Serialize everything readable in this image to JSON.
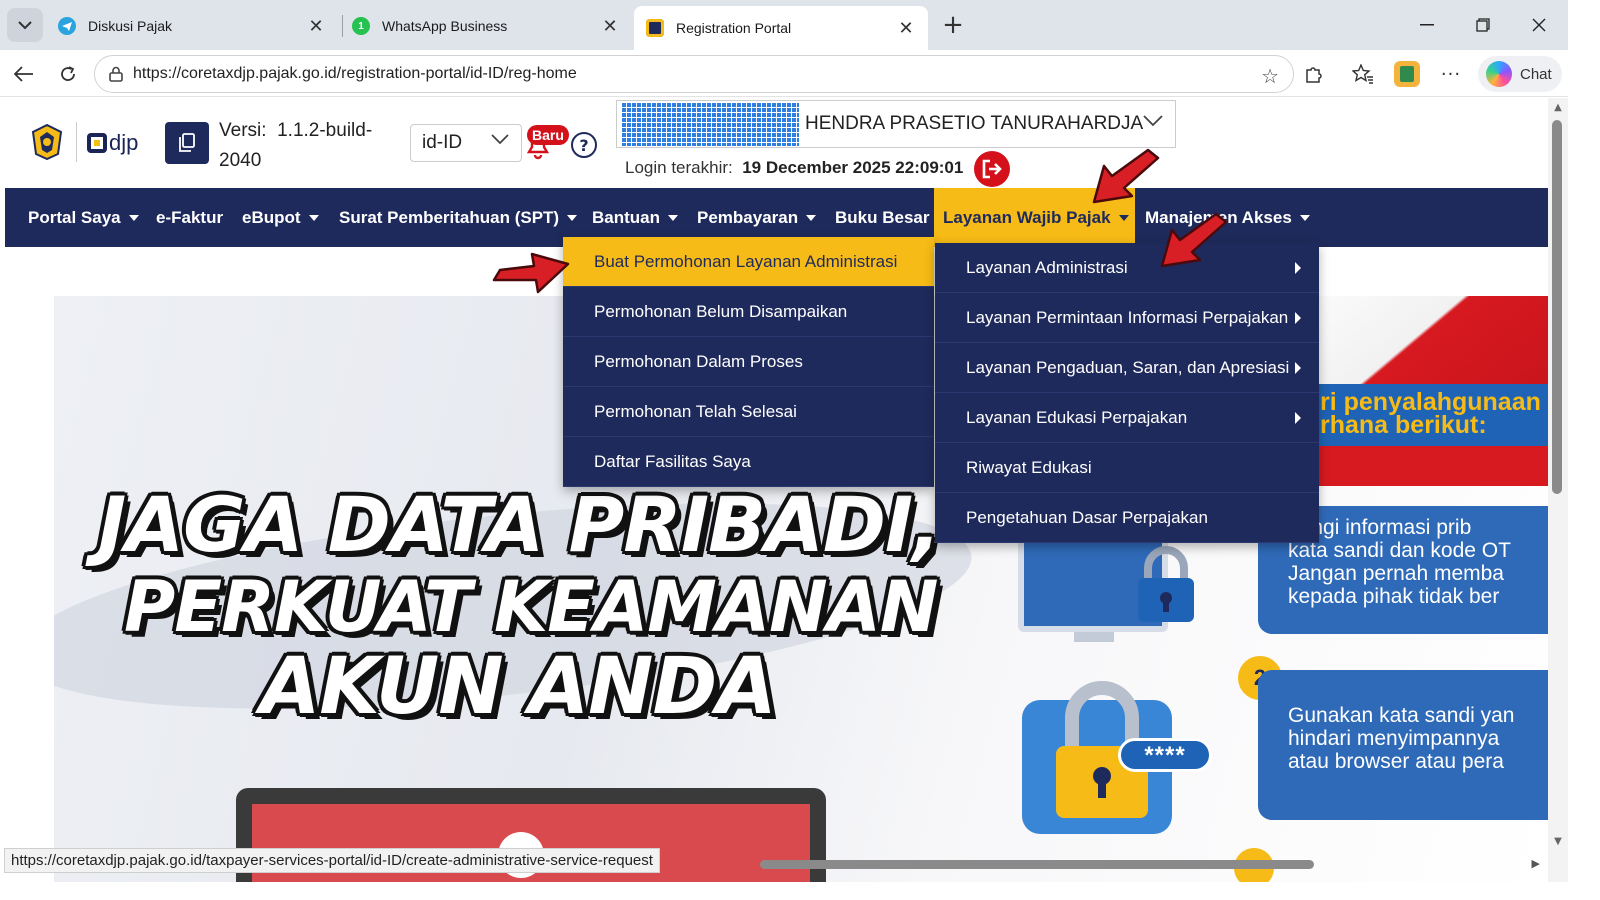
{
  "browser": {
    "tabs": [
      {
        "label": "Diskusi Pajak",
        "icon": "telegram-icon"
      },
      {
        "label": "WhatsApp Business",
        "icon": "whatsapp-business-icon"
      },
      {
        "label": "Registration Portal",
        "icon": "coretax-icon"
      }
    ],
    "url": "https://coretaxdjp.pajak.go.id/registration-portal/id-ID/reg-home",
    "chat_label": "Chat",
    "status_url": "https://coretaxdjp.pajak.go.id/taxpayer-services-portal/id-ID/create-administrative-service-request"
  },
  "header": {
    "logo_text": "djp",
    "version_label": "Versi:",
    "version_value": "1.1.2-build-2040",
    "language": "id-ID",
    "new_badge": "Baru",
    "help_symbol": "?",
    "user_name": "HENDRA PRASETIO TANURAHARDJA",
    "last_login_label": "Login terakhir:",
    "last_login_value": "19 December 2025 22:09:01"
  },
  "nav": {
    "items": [
      "Portal Saya",
      "e-Faktur",
      "eBupot",
      "Surat Pemberitahuan (SPT)",
      "Bantuan",
      "Pembayaran",
      "Buku Besar",
      "Layanan Wajib Pajak",
      "Manajemen Akses"
    ],
    "active": "Layanan Wajib Pajak"
  },
  "menus": {
    "layanan_administrasi": [
      "Buat Permohonan Layanan Administrasi",
      "Permohonan Belum Disampaikan",
      "Permohonan Dalam Proses",
      "Permohonan Telah Selesai",
      "Daftar Fasilitas Saya"
    ],
    "layanan_wajib_pajak": [
      "Layanan Administrasi",
      "Layanan Permintaan Informasi Perpajakan",
      "Layanan Pengaduan, Saran, dan Apresiasi",
      "Layanan Edukasi Perpajakan",
      "Riwayat Edukasi",
      "Pengetahuan Dasar Perpajakan"
    ],
    "highlighted": "Buat Permohonan Layanan Administrasi"
  },
  "banner": {
    "headline": [
      "JAGA DATA PRIBADI,",
      "PERKUAT KEAMANAN",
      "AKUN ANDA"
    ],
    "side_title": [
      "ri penyalahgunaan",
      "rhana berikut:"
    ],
    "tip1": [
      "dungi informasi prib",
      "kata sandi dan kode OT",
      "Jangan pernah memba",
      "kepada pihak tidak ber"
    ],
    "tip2_number": "2",
    "tip2": [
      "Gunakan kata sandi yan",
      "hindari menyimpannya",
      "atau browser atau pera"
    ],
    "password_mask": "****"
  },
  "colors": {
    "navy": "#1f2a5c",
    "accent_yellow": "#f6bb16",
    "danger_red": "#d4101b",
    "card_blue": "#2f6ab9"
  }
}
